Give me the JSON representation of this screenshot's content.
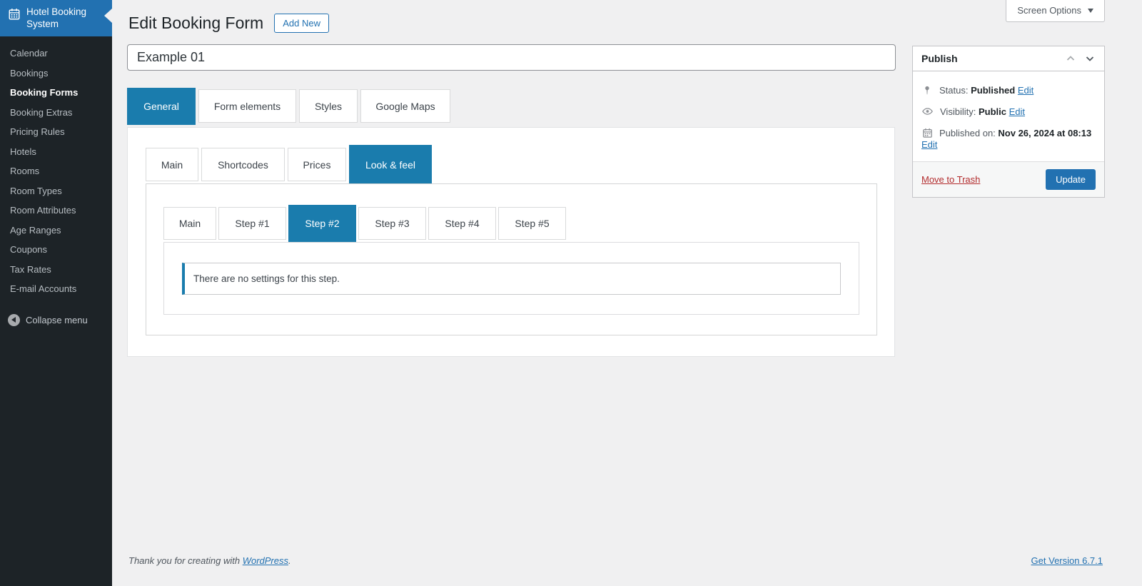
{
  "sidebar": {
    "header": {
      "title": "Hotel Booking System"
    },
    "items": [
      {
        "label": "Calendar",
        "active": false
      },
      {
        "label": "Bookings",
        "active": false
      },
      {
        "label": "Booking Forms",
        "active": true
      },
      {
        "label": "Booking Extras",
        "active": false
      },
      {
        "label": "Pricing Rules",
        "active": false
      },
      {
        "label": "Hotels",
        "active": false
      },
      {
        "label": "Rooms",
        "active": false
      },
      {
        "label": "Room Types",
        "active": false
      },
      {
        "label": "Room Attributes",
        "active": false
      },
      {
        "label": "Age Ranges",
        "active": false
      },
      {
        "label": "Coupons",
        "active": false
      },
      {
        "label": "Tax Rates",
        "active": false
      },
      {
        "label": "E-mail Accounts",
        "active": false
      }
    ],
    "collapse_label": "Collapse menu"
  },
  "screen_options": {
    "label": "Screen Options"
  },
  "page": {
    "title": "Edit Booking Form",
    "add_new_label": "Add New",
    "form_title_value": "Example 01"
  },
  "tabs": {
    "primary": [
      {
        "label": "General",
        "active": true
      },
      {
        "label": "Form elements",
        "active": false
      },
      {
        "label": "Styles",
        "active": false
      },
      {
        "label": "Google Maps",
        "active": false
      }
    ],
    "secondary": [
      {
        "label": "Main",
        "active": false
      },
      {
        "label": "Shortcodes",
        "active": false
      },
      {
        "label": "Prices",
        "active": false
      },
      {
        "label": "Look & feel",
        "active": true
      }
    ],
    "steps": [
      {
        "label": "Main",
        "active": false
      },
      {
        "label": "Step #1",
        "active": false
      },
      {
        "label": "Step #2",
        "active": true
      },
      {
        "label": "Step #3",
        "active": false
      },
      {
        "label": "Step #4",
        "active": false
      },
      {
        "label": "Step #5",
        "active": false
      }
    ]
  },
  "step_panel": {
    "notice": "There are no settings for this step."
  },
  "publish_box": {
    "title": "Publish",
    "status_label": "Status:",
    "status_value": "Published",
    "status_edit": "Edit",
    "visibility_label": "Visibility:",
    "visibility_value": "Public",
    "visibility_edit": "Edit",
    "published_label": "Published on:",
    "published_value": "Nov 26, 2024 at 08:13",
    "published_edit": "Edit",
    "trash_label": "Move to Trash",
    "update_label": "Update"
  },
  "footer": {
    "left_prefix": "Thank you for creating with ",
    "left_link": "WordPress",
    "left_suffix": ".",
    "right_link": "Get Version 6.7.1"
  },
  "icons": {
    "sidebar_logo": "calendar-icon",
    "collapse": "collapse-arrow-icon",
    "screen_options": "triangle-down-icon",
    "publish_header": [
      "chevron-up-icon",
      "chevron-down-icon"
    ],
    "status": "pin-icon",
    "visibility": "eye-icon",
    "published_on": "calendar-icon"
  },
  "colors": {
    "accent_blue": "#2271b1",
    "tab_blue": "#1a7cad",
    "sidebar_bg": "#1d2327",
    "sidebar_header_bg": "#2271b1",
    "content_bg": "#f0f0f1",
    "trash_red": "#b32d2e"
  }
}
